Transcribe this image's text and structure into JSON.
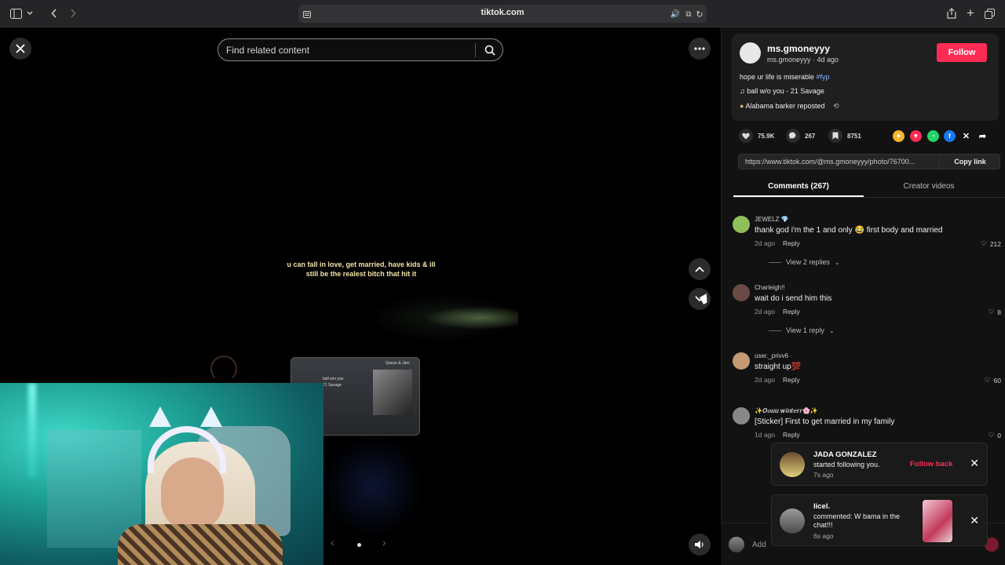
{
  "browser": {
    "url": "tiktok.com",
    "icons": [
      "sidebar-icon",
      "chevron-down-icon",
      "back-icon",
      "forward-icon",
      "page-settings-icon",
      "sound-icon",
      "translate-icon",
      "reload-icon",
      "share-icon",
      "new-tab-icon",
      "tab-overview-icon"
    ]
  },
  "video": {
    "search_placeholder": "Find related content",
    "caption": "u can fall in love, get married, have kids & ill still be the realest bitch that hit it",
    "car_screen": {
      "title": "ball w/o you",
      "artist": "21 Savage",
      "queue": "Queue & Jam"
    }
  },
  "post": {
    "author_name": "ms.gmoneyyy",
    "author_sub": "ms.gmoneyyy · 4d ago",
    "follow_label": "Follow",
    "description": "hope ur life is miserable ",
    "hashtag": "#fyp",
    "music": "ball w/o you - 21 Savage",
    "repost": "Alabama barker reposted",
    "likes": "75.9K",
    "comments": "267",
    "saves": "8751",
    "link": "https://www.tiktok.com/@ms.gmoneyyy/photo/76700...",
    "copy_link_label": "Copy link"
  },
  "tabs": {
    "comments": "Comments (267)",
    "creator": "Creator videos"
  },
  "comments": [
    {
      "user": "JEWELZ 💎",
      "text": "thank god i'm the 1 and only 😂 first body and married",
      "time": "2d ago",
      "reply": "Reply",
      "likes": "212",
      "view_replies": "View 2 replies"
    },
    {
      "user": "Charleigh!!",
      "text": "wait do i send him this",
      "time": "2d ago",
      "reply": "Reply",
      "likes": "8",
      "view_replies": "View 1 reply"
    },
    {
      "user": "user._privv6",
      "text": "straight up💯",
      "time": "2d ago",
      "reply": "Reply",
      "likes": "60"
    },
    {
      "user": "✨𝑶𝒐𝒖𝒖 𝒘𝒊𝒏𝒕𝒆𝒓𝒓🌸✨",
      "text": "[Sticker] First to get married in my family",
      "time": "1d ago",
      "reply": "Reply",
      "likes": "0"
    }
  ],
  "notifications": [
    {
      "name": "JADA GONZALEZ",
      "text": "started following you.",
      "time": "7s ago",
      "action": "Follow back"
    },
    {
      "name": "licel.",
      "text": "commented: W bama in the chat!!!",
      "time": "6s ago"
    }
  ],
  "add_comment_placeholder": "Add",
  "colors": {
    "accent": "#fe2c55",
    "hashtag": "#7fb6ff",
    "panel_bg": "#121212"
  }
}
